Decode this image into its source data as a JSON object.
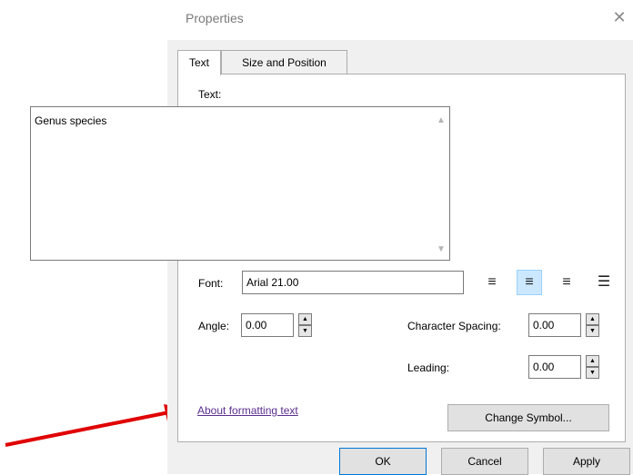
{
  "dialog": {
    "title": "Properties",
    "close_icon": "close-icon"
  },
  "tabs": [
    {
      "label": "Text",
      "active": true
    },
    {
      "label": "Size and Position",
      "active": false
    }
  ],
  "text_section": {
    "label": "Text:",
    "value": "Genus species"
  },
  "font": {
    "label": "Font:",
    "value": "Arial 21.00"
  },
  "alignment": {
    "options": [
      "align-left-icon",
      "align-center-icon",
      "align-right-icon",
      "align-justify-icon"
    ],
    "selected": "align-center-icon"
  },
  "angle": {
    "label": "Angle:",
    "value": "0.00"
  },
  "character_spacing": {
    "label": "Character Spacing:",
    "value": "0.00"
  },
  "leading": {
    "label": "Leading:",
    "value": "0.00"
  },
  "link": {
    "text": "About formatting text"
  },
  "buttons": {
    "change_symbol": "Change Symbol...",
    "ok": "OK",
    "cancel": "Cancel",
    "apply": "Apply"
  },
  "colors": {
    "link": "#5b2d8e",
    "active_align": "#cce8ff",
    "annotation_arrow": "#e00000"
  }
}
